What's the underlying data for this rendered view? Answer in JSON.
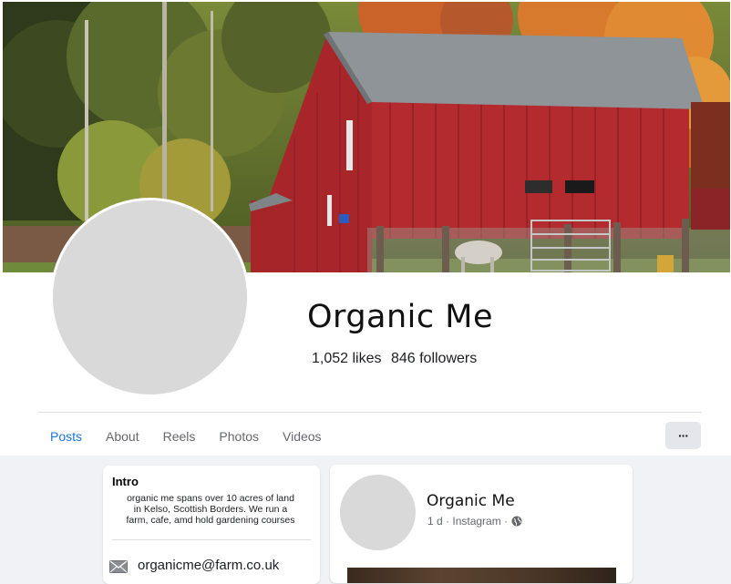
{
  "page": {
    "name": "Organic Me",
    "likes": "1,052 likes",
    "followers": "846 followers"
  },
  "tabs": [
    {
      "label": "Posts",
      "active": true
    },
    {
      "label": "About",
      "active": false
    },
    {
      "label": "Reels",
      "active": false
    },
    {
      "label": "Photos",
      "active": false
    },
    {
      "label": "Videos",
      "active": false
    }
  ],
  "more_button": {
    "label": "···",
    "icon": "more-horizontal-icon"
  },
  "intro": {
    "title": "Intro",
    "bio": "organic me spans over 10 acres of land in Kelso, Scottish Borders. We run a farm, cafe, amd hold gardening courses",
    "email": "organicme@farm.co.uk",
    "email_icon": "envelope-icon"
  },
  "post": {
    "author": "Organic Me",
    "time": "1 d",
    "source": "Instagram",
    "privacy_icon": "globe-icon"
  },
  "colors": {
    "accent": "#1b74e4",
    "muted_text": "#65676b",
    "page_bg": "#f0f2f5",
    "placeholder": "#d9d9d9"
  }
}
